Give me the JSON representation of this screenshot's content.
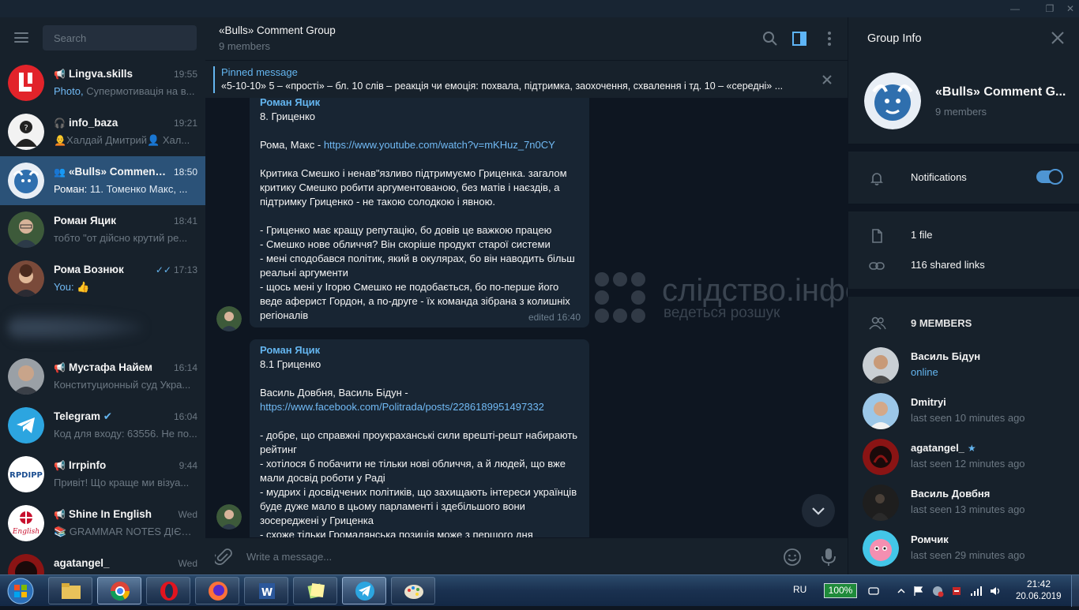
{
  "window": {
    "minimize": "—",
    "restore": "❐",
    "close": "✕"
  },
  "sidebar": {
    "search_placeholder": "Search",
    "chats": [
      {
        "name": "Lingva.skills",
        "icon": "megaphone-icon",
        "time": "19:55",
        "sender": "Photo,",
        "preview": " Супермотивація на в..."
      },
      {
        "name": "info_baza",
        "icon": "bot-icon",
        "time": "19:21",
        "sender": "",
        "preview": "🧑‍🦲Халдай Дмитрий👤 Хал..."
      },
      {
        "name": "«Bulls» Comment ...",
        "icon": "group-icon",
        "time": "18:50",
        "sender": "Роман:",
        "preview": " 11. Томенко  Макс, ..."
      },
      {
        "name": "Роман Яцик",
        "icon": "",
        "time": "18:41",
        "sender": "",
        "preview": "тобто \"от дійсно крутий ре..."
      },
      {
        "name": "Рома Вознюк",
        "icon": "",
        "time": "17:13",
        "sender": "You:",
        "preview": " 👍"
      },
      {
        "name": "",
        "icon": "",
        "time": "",
        "sender": "",
        "preview": ""
      },
      {
        "name": "Мустафа Найем",
        "icon": "megaphone-icon",
        "time": "16:14",
        "sender": "",
        "preview": "Конституционный суд Укра..."
      },
      {
        "name": "Telegram",
        "icon": "verified-icon",
        "time": "16:04",
        "sender": "",
        "preview": "Код для входу: 63556. Не по..."
      },
      {
        "name": "Irrpinfo",
        "icon": "megaphone-icon",
        "time": "9:44",
        "sender": "",
        "preview": "Привіт!  Що краще ми візуа..."
      },
      {
        "name": "Shine In English",
        "icon": "megaphone-icon",
        "time": "Wed",
        "sender": "",
        "preview": "📚 GRAMMAR NOTES ДІЄСЛ..."
      },
      {
        "name": "agatangel_",
        "icon": "",
        "time": "Wed",
        "sender": "",
        "preview": ""
      }
    ]
  },
  "chat": {
    "title": "«Bulls» Comment Group",
    "subtitle": "9 members",
    "pinned_title": "Pinned message",
    "pinned_text": "«5-10-10»  5 – «прості» – бл. 10 слів – реакція чи емоція: похвала, підтримка, заохочення, схвалення і тд. 10 – «середні» ...",
    "messages": [
      {
        "author": "Роман Яцик",
        "lines": [
          "8. Гриценко",
          "",
          "Рома, Макс - ",
          "",
          "Критика Смешко і ненав\"язливо підтримуємо Гриценка. загалом критику Смешко робити аргументованою, без матів і наєздів, а підтримку Гриценко - не такою солодкою і явною.",
          "",
          "- Гриценко має кращу репутацію, бо довів це важкою працею",
          "- Смешко нове обличчя? Він скоріше продукт старої системи",
          "- мені сподобався політик, який в окулярах, бо він наводить більш реальні аргументи",
          "- щось мені у Ігорю Смешко не подобається, бо по-перше його веде аферист Гордон, а по-друге - їх команда зібрана з колишніх регіоналів"
        ],
        "link": "https://www.youtube.com/watch?v=mKHuz_7n0CY",
        "edited": "edited 16:40"
      },
      {
        "author": "Роман Яцик",
        "lines": [
          "8.1 Гриценко",
          "",
          "Василь Довбня, Василь Бідун - ",
          "",
          "- добре, що справжні проукраханські сили врешті-решт набирають рейтинг",
          "- хотілося б побачити не тільки нові обличчя, а й людей, що вже мали досвід роботи у Раді",
          "- мудрих і досвідчених політиків, що захищають інтереси українців буде дуже мало в цьому парламенті і здебільшого вони зосереджені у Гриценка",
          "- схоже тільки Громадянська позиція може з першого дня"
        ],
        "link": "https://www.facebook.com/Politrada/posts/2286189951497332",
        "edited": ""
      }
    ],
    "watermark_main": "слідство.інфо",
    "watermark_sub": "ведеться розшук",
    "compose_placeholder": "Write a message..."
  },
  "info": {
    "title": "Group Info",
    "group_name": "«Bulls» Comment G...",
    "group_members": "9 members",
    "notifications_label": "Notifications",
    "notifications_on": true,
    "files": "1 file",
    "links": "116 shared links",
    "members_header": "9 MEMBERS",
    "members": [
      {
        "name": "Василь Бідун",
        "status": "online",
        "online": true
      },
      {
        "name": "Dmitryi",
        "status": "last seen 10 minutes ago",
        "online": false
      },
      {
        "name": "agatangel_",
        "status": "last seen 12 minutes ago",
        "online": false,
        "star": "★"
      },
      {
        "name": "Василь Довбня",
        "status": "last seen 13 minutes ago",
        "online": false
      },
      {
        "name": "Ромчик",
        "status": "last seen 29 minutes ago",
        "online": false
      }
    ]
  },
  "taskbar": {
    "lang": "RU",
    "battery": "100%",
    "time": "21:42",
    "date": "20.06.2019",
    "apps": [
      "file-explorer-icon",
      "chrome-icon",
      "opera-icon",
      "firefox-icon",
      "word-icon",
      "sticky-notes-icon",
      "telegram-icon",
      "paint-icon"
    ]
  }
}
